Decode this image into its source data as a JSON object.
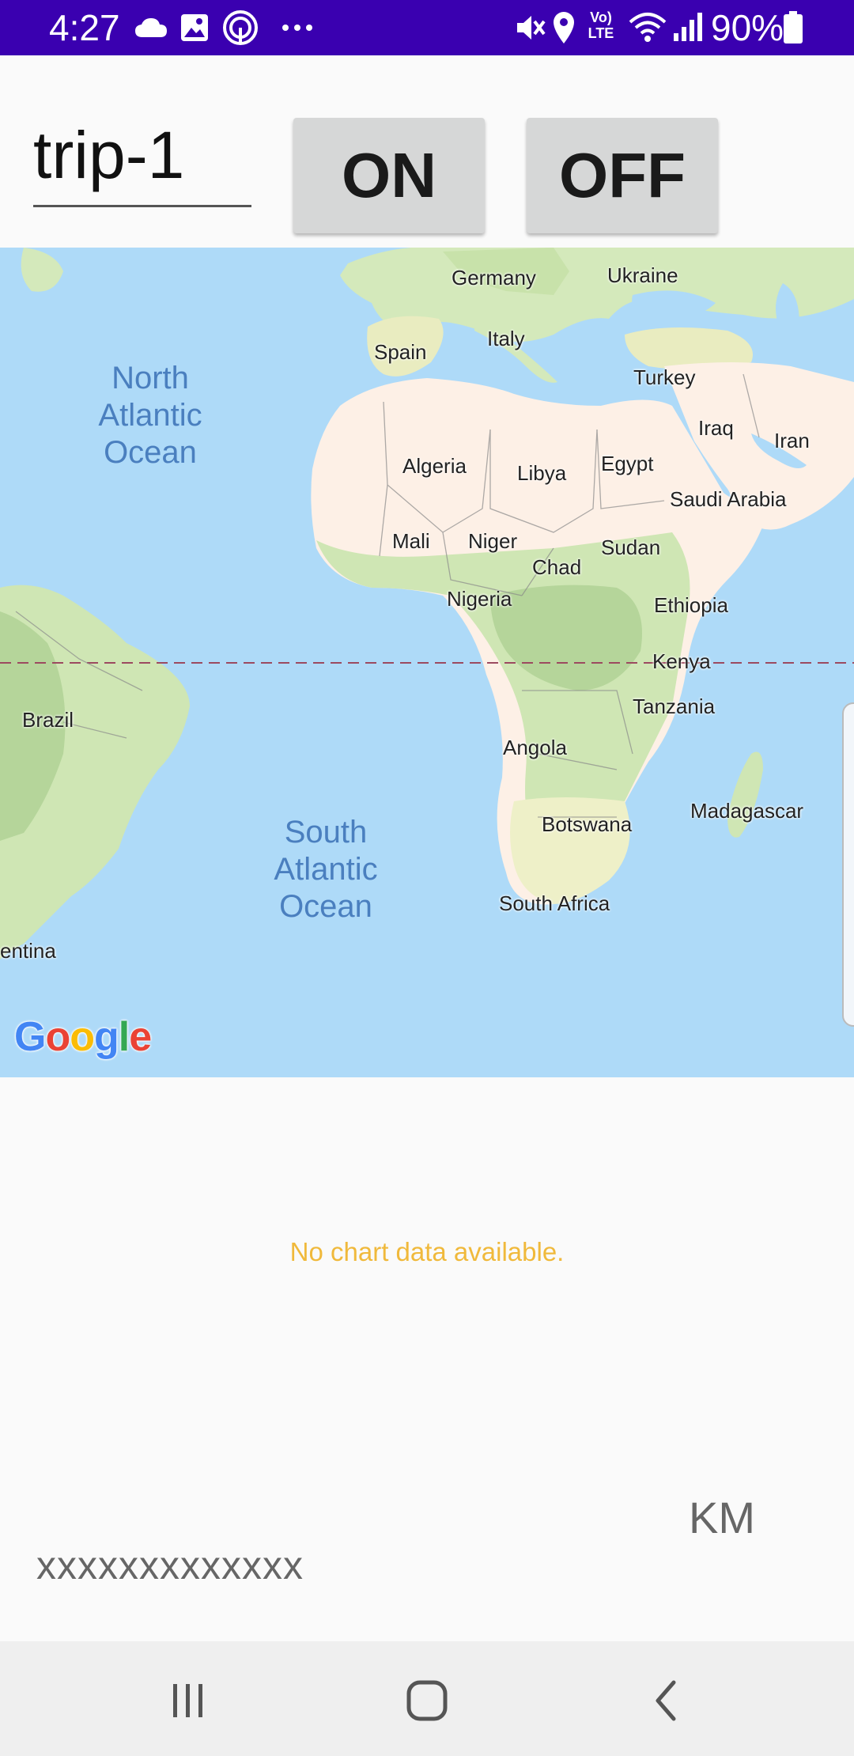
{
  "status_bar": {
    "time": "4:27",
    "battery": "90%",
    "icons": [
      "cloud-icon",
      "image-icon",
      "nfc-icon",
      "more-icon",
      "mute-icon",
      "location-icon",
      "volte-icon",
      "wifi-icon",
      "signal-icon",
      "battery-icon"
    ],
    "volte_label": "Vo) LTE",
    "background": "#3a00b0"
  },
  "controls": {
    "trip_name": "trip-1",
    "on_label": "ON",
    "off_label": "OFF"
  },
  "map": {
    "provider": "Google",
    "countries": [
      "Germany",
      "Ukraine",
      "Spain",
      "Italy",
      "Turkey",
      "Iraq",
      "Iran",
      "Algeria",
      "Libya",
      "Egypt",
      "Saudi Arabia",
      "Mali",
      "Niger",
      "Chad",
      "Sudan",
      "Nigeria",
      "Ethiopia",
      "Kenya",
      "Brazil",
      "Tanzania",
      "Angola",
      "Madagascar",
      "Botswana",
      "South Africa",
      "entina"
    ],
    "oceans": [
      "North\nAtlantic\nOcean",
      "South\nAtlantic\nOcean"
    ],
    "water_color": "#aedaf8",
    "land_color": "#fdf2e8",
    "vegetation_color": "#cfe6b4"
  },
  "chart": {
    "empty_message": "No chart data available.",
    "empty_color": "#f0b93b"
  },
  "distance": {
    "value": "xxxxxxxxxxxxx",
    "unit": "KM"
  },
  "nav_bar": {
    "buttons": [
      "recent-apps",
      "home",
      "back"
    ]
  }
}
